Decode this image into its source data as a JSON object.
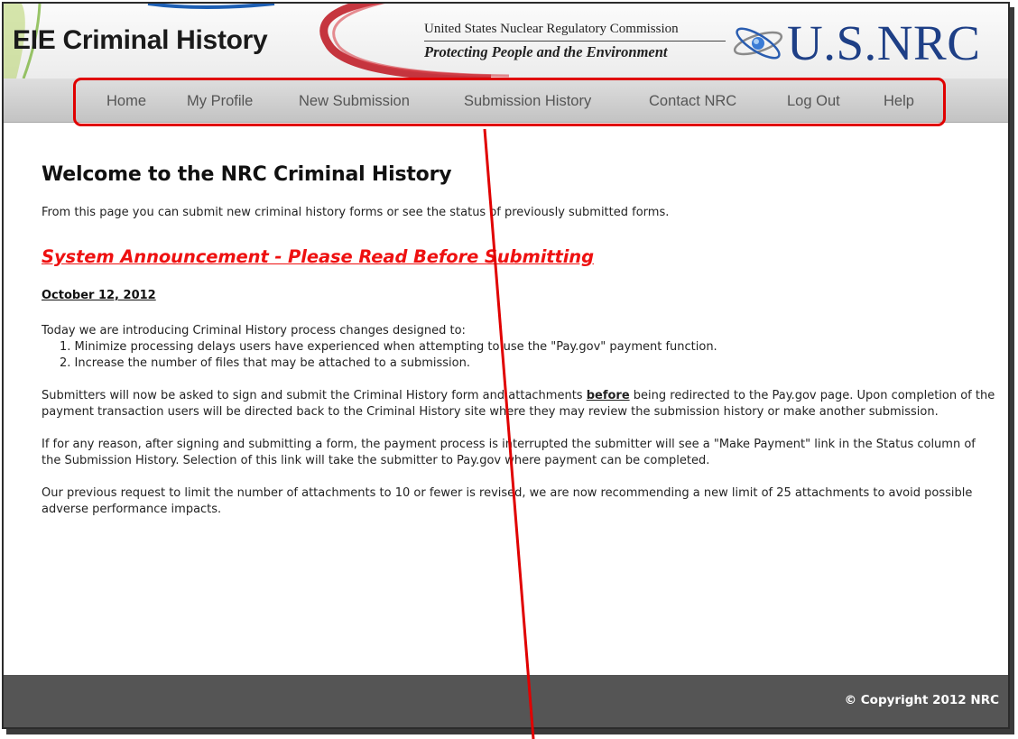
{
  "header": {
    "app_title": "EIE Criminal History",
    "agency_name": "United States Nuclear Regulatory Commission",
    "tagline": "Protecting People and the Environment",
    "logo_text": "U.S.NRC"
  },
  "nav": {
    "items": [
      {
        "label": "Home"
      },
      {
        "label": "My Profile"
      },
      {
        "label": "New Submission"
      },
      {
        "label": "Submission History"
      },
      {
        "label": "Contact NRC"
      },
      {
        "label": "Log Out"
      },
      {
        "label": "Help"
      }
    ]
  },
  "main": {
    "title": "Welcome to the NRC Criminal History",
    "intro": "From this page you can submit new criminal history forms or see the status of previously submitted forms.",
    "announcement_link": "System Announcement - Please Read Before Submitting",
    "date": "October 12, 2012",
    "p1": "Today we are introducing Criminal History process changes designed to:",
    "list": [
      "1. Minimize processing delays users have experienced when attempting to use the \"Pay.gov\" payment function.",
      "2. Increase the number of files that may be attached to a submission."
    ],
    "p2_before": "Submitters will now be asked to sign and submit the Criminal History form and attachments ",
    "p2_bold": "before",
    "p2_after": " being redirected to the Pay.gov page. Upon completion of the payment transaction users will be directed back to the Criminal History site where they may review the submission history or make another submission.",
    "p3": "If for any reason, after signing and submitting a form, the payment process is interrupted the submitter will see a \"Make Payment\" link in the Status column of the Submission History. Selection of this link will take the submitter to Pay.gov where payment can be completed.",
    "p4": "Our previous request to limit the number of attachments to 10 or fewer is revised, we are now recommending a new limit of 25 attachments to avoid possible adverse performance impacts."
  },
  "footer": {
    "copyright": "© Copyright 2012 NRC"
  },
  "colors": {
    "announcement": "#ee1111",
    "highlight": "#e00000",
    "footer_bg": "#555555",
    "logo_blue": "#1e3f86"
  }
}
